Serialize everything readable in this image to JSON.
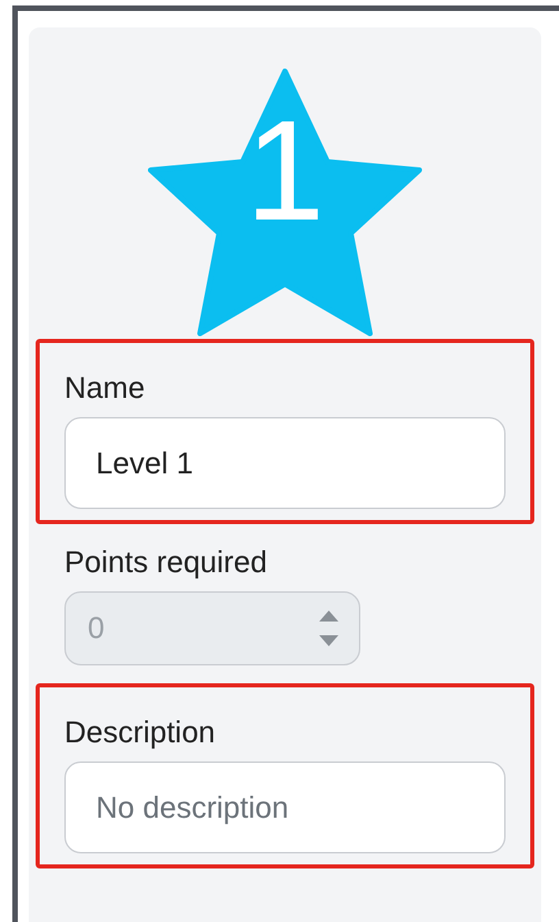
{
  "badge": {
    "number": "1"
  },
  "fields": [
    {
      "kind": "text",
      "label": "Name",
      "value": "Level 1",
      "highlighted": true,
      "disabled": false
    },
    {
      "kind": "number",
      "label": "Points required",
      "value": "0",
      "highlighted": false,
      "disabled": true
    },
    {
      "kind": "text",
      "label": "Description",
      "placeholder": "No description",
      "highlighted": true,
      "disabled": false
    }
  ]
}
